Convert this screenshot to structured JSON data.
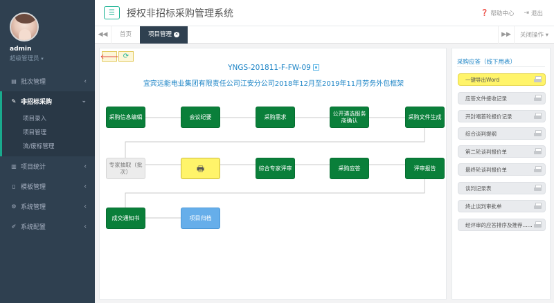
{
  "user": {
    "name": "admin",
    "role": "超级管理员"
  },
  "sidebar": {
    "items": [
      {
        "label": "批次管理",
        "icon": "doc-icon"
      },
      {
        "label": "非招标采购",
        "icon": "edit-icon",
        "children": [
          "项目录入",
          "项目管理",
          "流/废标管理"
        ]
      },
      {
        "label": "项目统计",
        "icon": "bar-chart-icon"
      },
      {
        "label": "模板管理",
        "icon": "file-icon"
      },
      {
        "label": "系统管理",
        "icon": "gears-icon"
      },
      {
        "label": "系统配置",
        "icon": "wrench-icon"
      }
    ]
  },
  "header": {
    "title": "授权非招标采购管理系统",
    "help": "帮助中心",
    "logout": "退出"
  },
  "tabs": {
    "items": [
      "首页",
      "项目管理"
    ],
    "close_ops": "关闭操作"
  },
  "main": {
    "code": "YNGS-201811-F-FW-09",
    "project_name": "宜宾远能电业集团有限责任公司江安分公司2018年12月至2019年11月劳务外包框架",
    "flow": {
      "row1": [
        "采购信息编辑",
        "会议纪要",
        "采购需求",
        "公开遴选服务商确认",
        "采购文件生成"
      ],
      "row2": [
        "专家抽取（批次）",
        "",
        "综合专家评审",
        "采购应答",
        "评审报告"
      ],
      "row3": [
        "成交通知书",
        "项目归档"
      ]
    }
  },
  "right_panel": {
    "title": "采购应答（线下用表）",
    "items": [
      "一键导出Word",
      "应答文件接收记录",
      "开封唱首轮报价记录",
      "综合谈判提纲",
      "第二轮谈判报价单",
      "最终轮谈判报价单",
      "谈判记录表",
      "终止谈判审批单",
      "经评审的应答排序及推荐......"
    ]
  },
  "colors": {
    "accent": "#1ab394",
    "sidebar": "#2f4050",
    "node_green": "#0a7f3a",
    "highlight": "#fff46a",
    "link": "#1c84c6"
  }
}
